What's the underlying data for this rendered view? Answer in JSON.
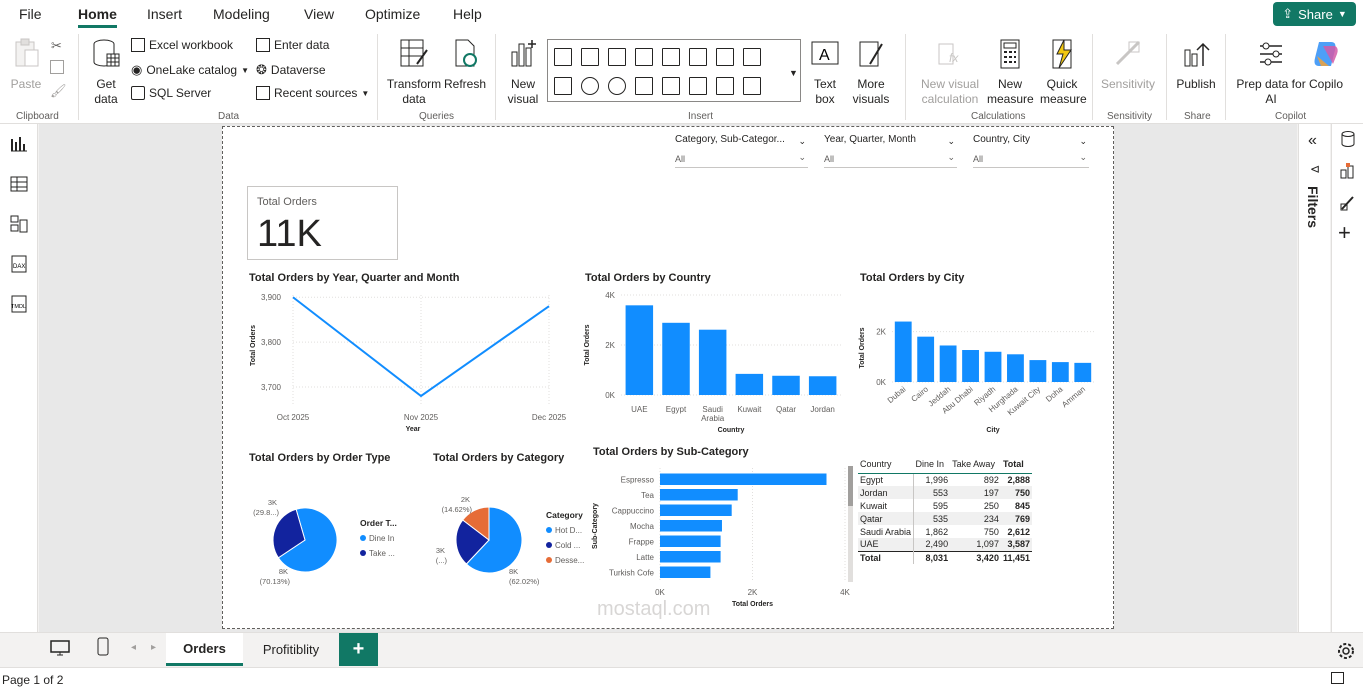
{
  "menu": {
    "items": [
      "File",
      "Home",
      "Insert",
      "Modeling",
      "View",
      "Optimize",
      "Help"
    ],
    "share": "Share"
  },
  "ribbon": {
    "clipboard": {
      "paste": "Paste",
      "label": "Clipboard"
    },
    "data": {
      "get_data": "Get data",
      "excel": "Excel workbook",
      "onelake": "OneLake catalog",
      "sql": "SQL Server",
      "enter_data": "Enter data",
      "dataverse": "Dataverse",
      "recent": "Recent sources",
      "label": "Data"
    },
    "queries": {
      "transform": "Transform data",
      "refresh": "Refresh",
      "label": "Queries"
    },
    "insert": {
      "new_visual": "New visual",
      "text_box": "Text box",
      "more_visuals": "More visuals",
      "label": "Insert"
    },
    "calculations": {
      "new_visual_calc": "New visual calculation",
      "new_measure": "New measure",
      "quick_measure": "Quick measure",
      "label": "Calculations"
    },
    "sensitivity": {
      "btn": "Sensitivity",
      "label": "Sensitivity"
    },
    "share": {
      "publish": "Publish",
      "label": "Share"
    },
    "copilot": {
      "prep": "Prep data for AI",
      "copilot": "Copilo",
      "label": "Copilot"
    }
  },
  "slicers": [
    {
      "title": "Category, Sub-Categor...",
      "value": "All"
    },
    {
      "title": "Year, Quarter, Month",
      "value": "All"
    },
    {
      "title": "Country, City",
      "value": "All"
    }
  ],
  "card": {
    "label": "Total Orders",
    "value": "11K"
  },
  "titles": {
    "line": "Total Orders by Year, Quarter and Month",
    "country": "Total Orders by Country",
    "city": "Total Orders by City",
    "order_type": "Total Orders by Order Type",
    "category": "Total Orders by Category",
    "subcat": "Total Orders by Sub-Category"
  },
  "chart_data": [
    {
      "type": "line",
      "title": "Total Orders by Year, Quarter and Month",
      "x": [
        "Oct 2025",
        "Nov 2025",
        "Dec 2025"
      ],
      "values": [
        3900,
        3680,
        3880
      ],
      "xlabel": "Year",
      "ylabel": "Total Orders",
      "yticks": [
        "3,900",
        "3,800",
        "3,700"
      ],
      "ylim": [
        3680,
        3905
      ]
    },
    {
      "type": "bar",
      "title": "Total Orders by Country",
      "categories": [
        "UAE",
        "Egypt",
        "Saudi Arabia",
        "Kuwait",
        "Qatar",
        "Jordan"
      ],
      "values": [
        3587,
        2888,
        2612,
        845,
        769,
        750
      ],
      "xlabel": "Country",
      "ylabel": "Total Orders",
      "yticks": [
        "4K",
        "2K",
        "0K"
      ],
      "ylim": [
        0,
        4000
      ]
    },
    {
      "type": "bar",
      "title": "Total Orders by City",
      "categories": [
        "Dubai",
        "Cairo",
        "Jeddah",
        "Abu Dhabi",
        "Riyadh",
        "Hurghada",
        "Kuwait City",
        "Doha",
        "Amman"
      ],
      "values": [
        2400,
        1800,
        1450,
        1270,
        1200,
        1100,
        870,
        790,
        760
      ],
      "xlabel": "City",
      "ylabel": "Total Orders",
      "yticks": [
        "2K",
        "0K"
      ],
      "ylim": [
        0,
        2700
      ]
    },
    {
      "type": "pie",
      "title": "Total Orders by Order Type",
      "legend_title": "Order T...",
      "slices": [
        {
          "name": "Dine In",
          "value": 8031,
          "label": "8K",
          "pct": "(70.13%)",
          "color": "#118dff"
        },
        {
          "name": "Take ...",
          "value": 3420,
          "label": "3K",
          "pct": "(29.8...)",
          "color": "#12239e"
        }
      ]
    },
    {
      "type": "pie",
      "title": "Total Orders by Category",
      "legend_title": "Category",
      "slices": [
        {
          "name": "Hot D...",
          "value": 62.02,
          "label": "8K",
          "pct": "(62.02%)",
          "color": "#118dff"
        },
        {
          "name": "Cold ...",
          "value": 23.36,
          "label": "3K",
          "pct": "(...)",
          "color": "#12239e"
        },
        {
          "name": "Desse...",
          "value": 14.62,
          "label": "2K",
          "pct": "(14.62%)",
          "color": "#e66c37"
        }
      ]
    },
    {
      "type": "bar",
      "orientation": "horizontal",
      "title": "Total Orders by Sub-Category",
      "categories": [
        "Espresso",
        "Tea",
        "Cappuccino",
        "Mocha",
        "Frappe",
        "Latte",
        "Turkish Cofe"
      ],
      "values": [
        3600,
        1680,
        1550,
        1340,
        1310,
        1310,
        1090
      ],
      "xlabel": "Total Orders",
      "ylabel": "Sub-Category",
      "xticks": [
        "0K",
        "2K",
        "4K"
      ],
      "xlim": [
        0,
        4000
      ]
    }
  ],
  "table": {
    "headers": [
      "Country",
      "Dine In",
      "Take Away",
      "Total"
    ],
    "rows": [
      [
        "Egypt",
        "1,996",
        "892",
        "2,888"
      ],
      [
        "Jordan",
        "553",
        "197",
        "750"
      ],
      [
        "Kuwait",
        "595",
        "250",
        "845"
      ],
      [
        "Qatar",
        "535",
        "234",
        "769"
      ],
      [
        "Saudi Arabia",
        "1,862",
        "750",
        "2,612"
      ],
      [
        "UAE",
        "2,490",
        "1,097",
        "3,587"
      ]
    ],
    "total": [
      "Total",
      "8,031",
      "3,420",
      "11,451"
    ]
  },
  "filters_label": "Filters",
  "tabs": [
    "Orders",
    "Profitiblity"
  ],
  "add_tab": "+",
  "status": "Page 1 of 2",
  "watermark": "mostaql.com",
  "colors": {
    "accent": "#117865",
    "bar": "#118dff",
    "dark": "#12239e",
    "orange": "#e66c37"
  }
}
